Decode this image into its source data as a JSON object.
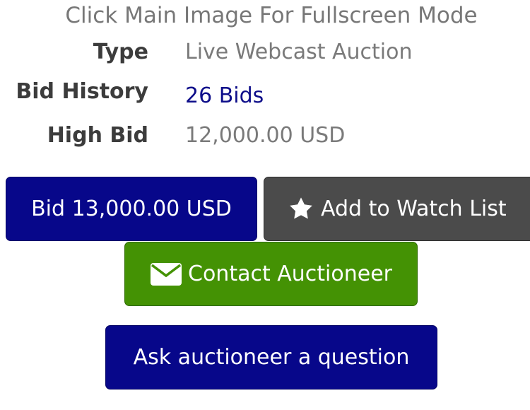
{
  "hint": "Click Main Image For Fullscreen Mode",
  "details": {
    "type_label": "Type",
    "type_value": "Live Webcast Auction",
    "bid_history_label": "Bid History",
    "bid_history_value": "26 Bids",
    "high_bid_label": "High Bid",
    "high_bid_value": "12,000.00 USD"
  },
  "buttons": {
    "bid": "Bid 13,000.00 USD",
    "watch": "Add to Watch List",
    "contact": "Contact Auctioneer",
    "ask": "Ask auctioneer a question"
  },
  "icons": {
    "watch": "star-icon",
    "contact": "envelope-icon"
  },
  "colors": {
    "primary_blue": "#07078a",
    "watch_gray": "#4b4b4b",
    "contact_green": "#449204",
    "link_blue": "#0e0e8a"
  }
}
